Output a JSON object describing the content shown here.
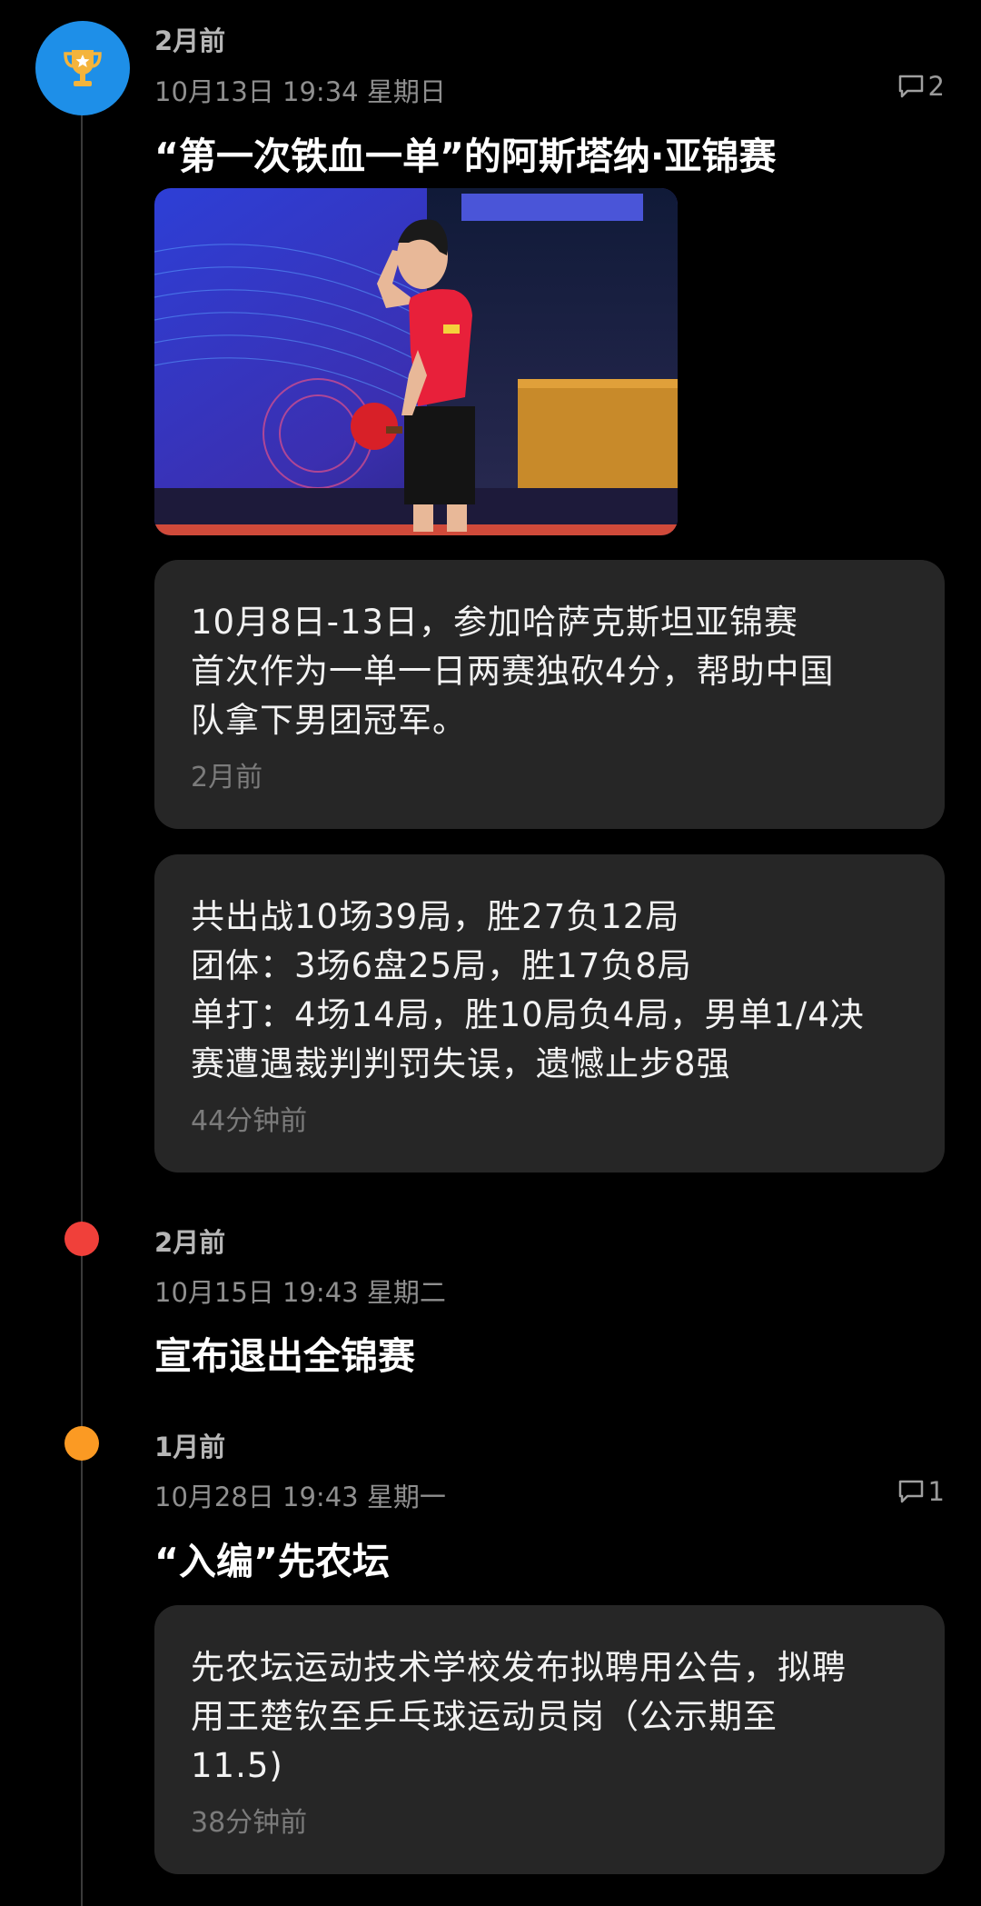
{
  "entries": [
    {
      "relative": "2月前",
      "date": "10月13日 19:34 星期日",
      "comments": "2",
      "title": "“第一次铁血一单”的阿斯塔纳·亚锦赛",
      "icon": "trophy-icon",
      "cards": [
        {
          "text": "10月8日-13日，参加哈萨克斯坦亚锦赛\n首次作为一单一日两赛独砍4分，帮助中国\n队拿下男团冠军。",
          "time": "2月前"
        },
        {
          "text": "共出战10场39局，胜27负12局\n团体：3场6盘25局，胜17负8局\n单打：4场14局，胜10局负4局，男单1/4决\n赛遭遇裁判判罚失误，遗憾止步8强",
          "time": "44分钟前"
        }
      ]
    },
    {
      "relative": "2月前",
      "date": "10月15日 19:43 星期二",
      "title": "宣布退出全锦赛"
    },
    {
      "relative": "1月前",
      "date": "10月28日 19:43 星期一",
      "comments": "1",
      "title": "“入编”先农坛",
      "cards": [
        {
          "text": "先农坛运动技术学校发布拟聘用公告，拟聘\n用王楚钦至乒乓球运动员岗（公示期至\n11.5)",
          "time": "38分钟前"
        }
      ]
    }
  ],
  "colors": {
    "badge_blue": "#1e8fe8",
    "dot_red": "#f0403a",
    "dot_orange": "#fb9a23",
    "card_bg": "#262626"
  }
}
